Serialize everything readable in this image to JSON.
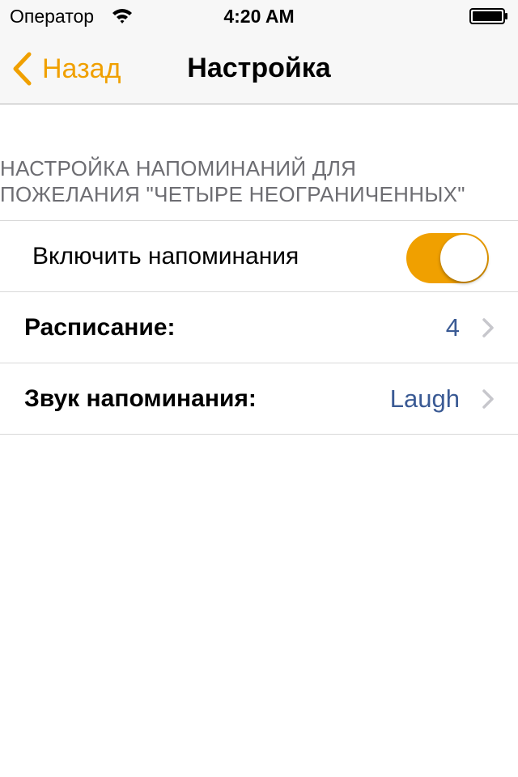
{
  "status_bar": {
    "carrier": "Оператор",
    "time": "4:20 AM",
    "wifi_icon": "wifi-icon",
    "battery_icon": "battery-icon"
  },
  "nav": {
    "back_label": "Назад",
    "title": "Настройка"
  },
  "section": {
    "header_line1": "НАСТРОЙКА НАПОМИНАНИЙ ДЛЯ",
    "header_line2": "ПОЖЕЛАНИЯ \"ЧЕТЫРЕ НЕОГРАНИЧЕННЫХ\""
  },
  "rows": {
    "reminders": {
      "label": "Включить напоминания",
      "enabled": true
    },
    "schedule": {
      "label": "Расписание:",
      "value": "4"
    },
    "sound": {
      "label": "Звук напоминания:",
      "value": "Laugh"
    }
  },
  "colors": {
    "accent": "#f0a000",
    "value_text": "#3a5a94",
    "header_text": "#6d6d72",
    "bar_background": "#f7f7f7"
  }
}
